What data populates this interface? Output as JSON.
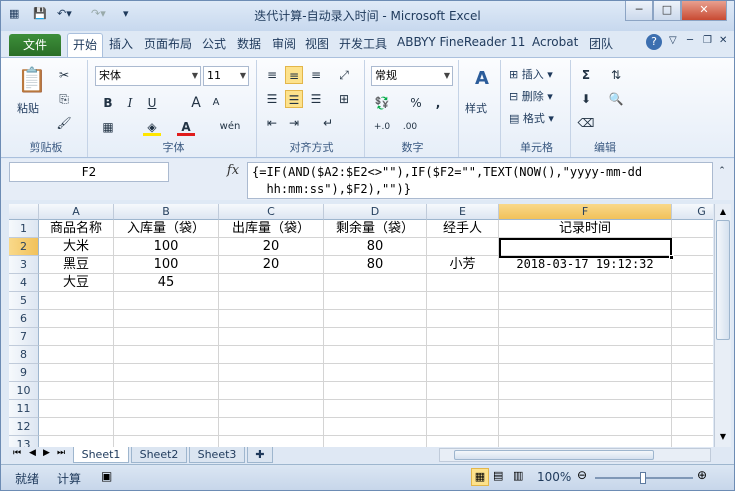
{
  "window": {
    "title": "迭代计算-自动录入时间 - Microsoft Excel"
  },
  "tabs": [
    "文件",
    "开始",
    "插入",
    "页面布局",
    "公式",
    "数据",
    "审阅",
    "视图",
    "开发工具",
    "ABBYY FineReader 11",
    "Acrobat",
    "团队"
  ],
  "ribbon": {
    "clipboard": {
      "paste": "粘贴",
      "label": "剪贴板"
    },
    "font": {
      "name": "宋体",
      "size": "11",
      "label": "字体",
      "bold": "B",
      "italic": "I",
      "underline": "U",
      "grow": "A",
      "shrink": "A",
      "wen": "wén"
    },
    "alignment": {
      "label": "对齐方式"
    },
    "number": {
      "format": "常规",
      "percent": "%",
      "comma": ",",
      "label": "数字"
    },
    "styles": {
      "label": "样式"
    },
    "cells": {
      "insert": "插入",
      "delete": "删除",
      "format": "格式",
      "label": "单元格"
    },
    "editing": {
      "sum": "Σ",
      "label": "编辑"
    }
  },
  "formula_bar": {
    "name_box": "F2",
    "fx": "fx",
    "formula": "{=IF(AND($A2:$E2<>\"\"),IF($F2=\"\",TEXT(NOW(),\"yyyy-mm-dd\n  hh:mm:ss\"),$F2),\"\")}"
  },
  "columns": [
    "A",
    "B",
    "C",
    "D",
    "E",
    "F",
    "G"
  ],
  "rows": [
    "1",
    "2",
    "3",
    "4",
    "5",
    "6",
    "7",
    "8",
    "9",
    "10",
    "11",
    "12",
    "13"
  ],
  "cells": [
    [
      "商品名称",
      "入库量（袋）",
      "出库量（袋）",
      "剩余量（袋）",
      "经手人",
      "记录时间"
    ],
    [
      "大米",
      "100",
      "20",
      "80",
      "",
      ""
    ],
    [
      "黑豆",
      "100",
      "20",
      "80",
      "小芳",
      "2018-03-17 19:12:32"
    ],
    [
      "大豆",
      "45",
      "",
      "",
      "",
      ""
    ]
  ],
  "sheets": [
    "Sheet1",
    "Sheet2",
    "Sheet3"
  ],
  "status": {
    "ready": "就绪",
    "calc": "计算",
    "zoom": "100%"
  }
}
